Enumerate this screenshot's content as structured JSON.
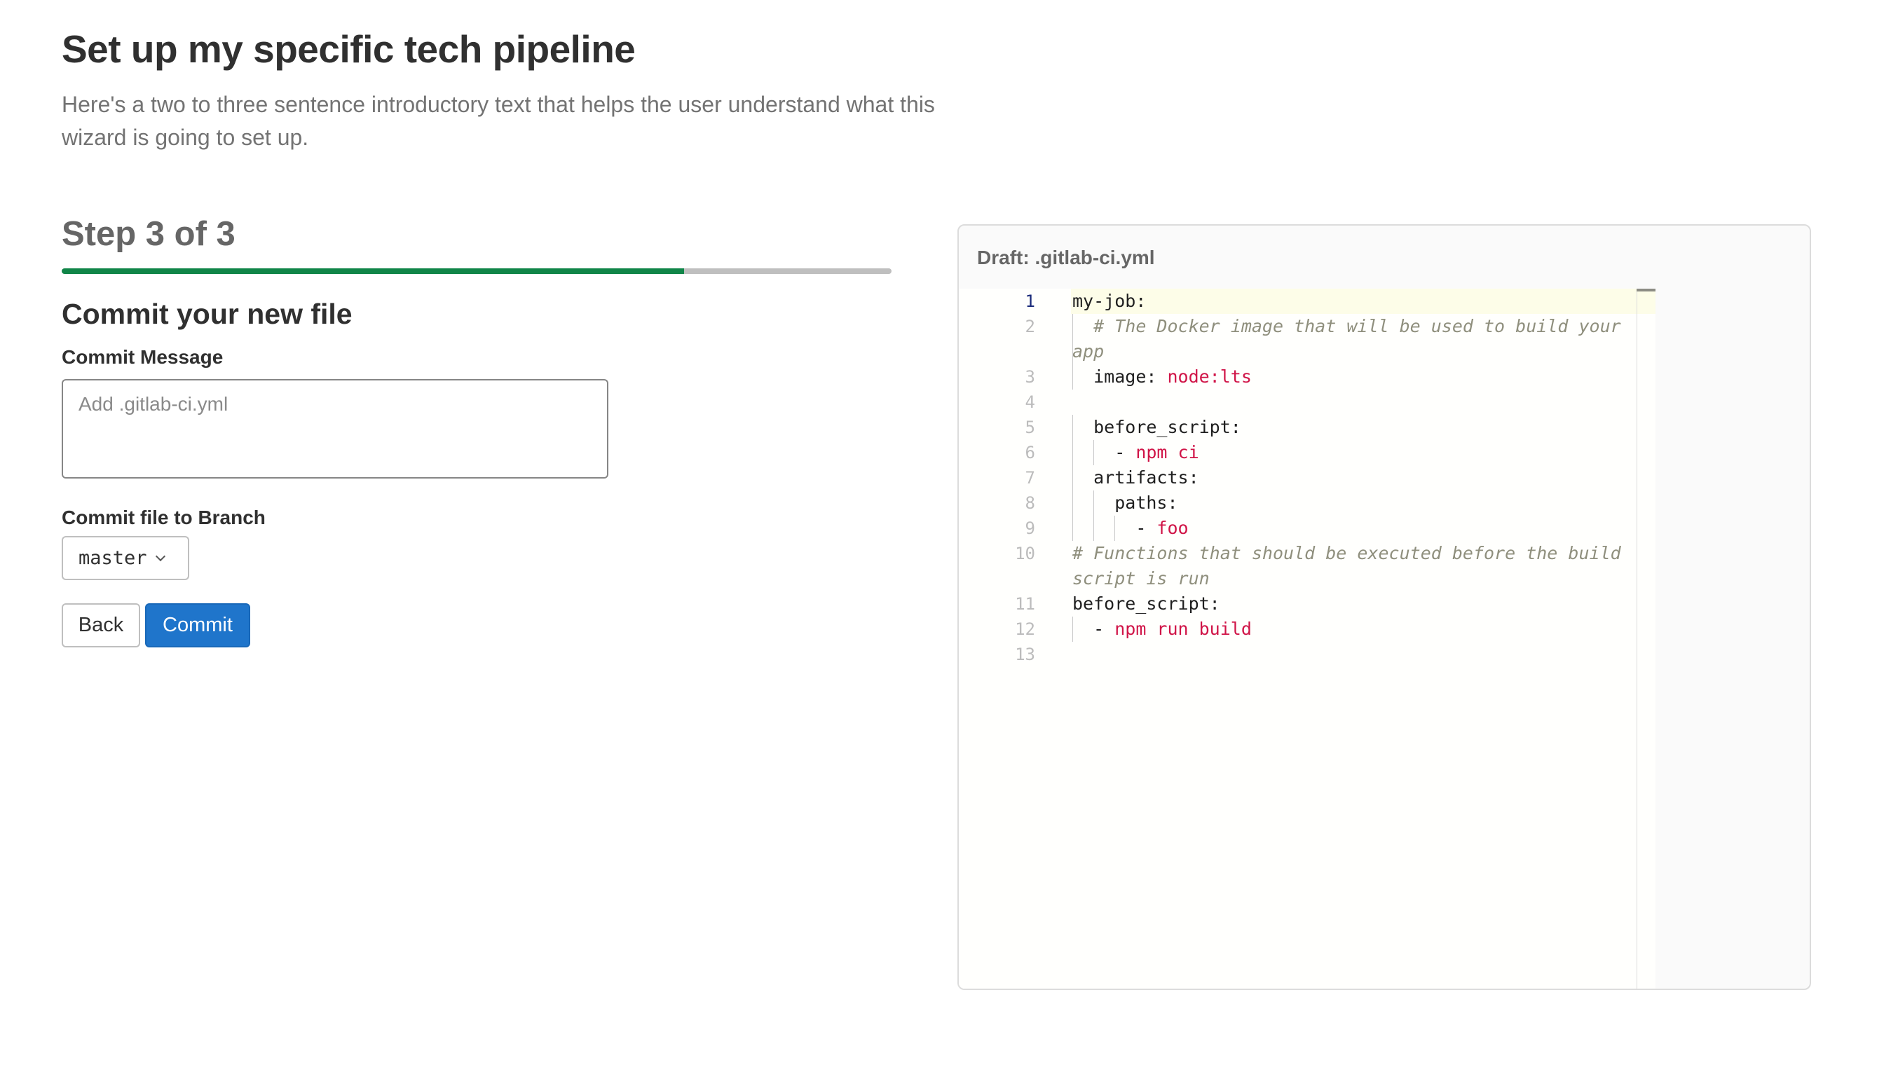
{
  "header": {
    "title": "Set up my specific tech pipeline",
    "intro": "Here's a two to three sentence introductory text that helps the user understand what this wizard is going to set up."
  },
  "wizard": {
    "step_label": "Step 3 of 3",
    "progress_fraction": 0.75,
    "colors": {
      "progress_fill": "#108548",
      "progress_track": "#bfbfbf",
      "primary": "#1f75cb"
    },
    "section_title": "Commit your new file",
    "commit_message": {
      "label": "Commit Message",
      "value": "",
      "placeholder": "Add .gitlab-ci.yml"
    },
    "branch": {
      "label": "Commit file to Branch",
      "selected": "master",
      "icon": "chevron-down-icon"
    },
    "buttons": {
      "back": "Back",
      "commit": "Commit"
    }
  },
  "draft": {
    "title": "Draft: .gitlab-ci.yml",
    "active_line": 1,
    "lines": [
      {
        "n": "1",
        "indent": 0,
        "key": "my-job:",
        "value": "",
        "comment": ""
      },
      {
        "n": "2",
        "indent": 2,
        "key": "",
        "value": "",
        "comment": "# The Docker image that will be used to build your app"
      },
      {
        "n": "3",
        "indent": 2,
        "key": "image: ",
        "value": "node:lts",
        "comment": ""
      },
      {
        "n": "4",
        "indent": 0,
        "key": "",
        "value": "",
        "comment": ""
      },
      {
        "n": "5",
        "indent": 2,
        "key": "before_script:",
        "value": "",
        "comment": ""
      },
      {
        "n": "6",
        "indent": 4,
        "key": "- ",
        "value": "npm ci",
        "comment": ""
      },
      {
        "n": "7",
        "indent": 2,
        "key": "artifacts:",
        "value": "",
        "comment": ""
      },
      {
        "n": "8",
        "indent": 4,
        "key": "paths:",
        "value": "",
        "comment": ""
      },
      {
        "n": "9",
        "indent": 6,
        "key": "- ",
        "value": "foo",
        "comment": ""
      },
      {
        "n": "10",
        "indent": 0,
        "key": "",
        "value": "",
        "comment": "# Functions that should be executed before the build script is run"
      },
      {
        "n": "11",
        "indent": 0,
        "key": "before_script:",
        "value": "",
        "comment": ""
      },
      {
        "n": "12",
        "indent": 2,
        "key": "- ",
        "value": "npm run build",
        "comment": ""
      },
      {
        "n": "13",
        "indent": 0,
        "key": "",
        "value": "",
        "comment": ""
      }
    ]
  }
}
